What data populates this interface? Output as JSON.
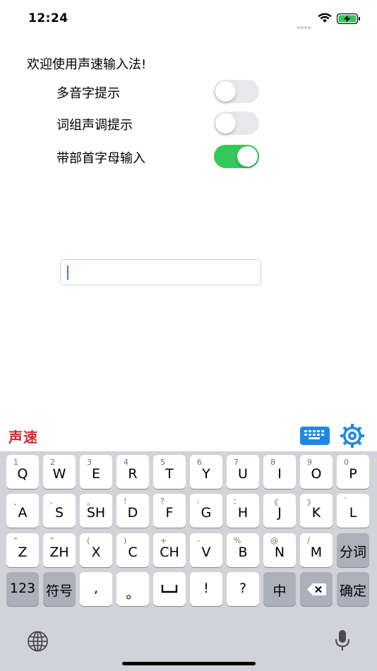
{
  "status_bar": {
    "time": "12:24"
  },
  "settings": {
    "welcome": "欢迎使用声速输入法!",
    "options": [
      {
        "label": "多音字提示",
        "on": false
      },
      {
        "label": "词组声调提示",
        "on": false
      },
      {
        "label": "带部首字母输入",
        "on": true
      }
    ]
  },
  "text_field": {
    "value": ""
  },
  "keyboard": {
    "brand": "声速",
    "rows": [
      [
        {
          "sub": "1",
          "main": "Q"
        },
        {
          "sub": "2",
          "main": "W"
        },
        {
          "sub": "3",
          "main": "E"
        },
        {
          "sub": "4",
          "main": "R"
        },
        {
          "sub": "5",
          "main": "T"
        },
        {
          "sub": "6",
          "main": "Y"
        },
        {
          "sub": "7",
          "main": "U"
        },
        {
          "sub": "8",
          "main": "I"
        },
        {
          "sub": "9",
          "main": "O"
        },
        {
          "sub": "0",
          "main": "P"
        }
      ],
      [
        {
          "sub": "、",
          "main": "A"
        },
        {
          "sub": ",",
          "main": "S"
        },
        {
          "sub": "。",
          "main": "SH"
        },
        {
          "sub": "!",
          "main": "D"
        },
        {
          "sub": "?",
          "main": "F"
        },
        {
          "sub": ":",
          "main": "G"
        },
        {
          "sub": ";",
          "main": "H"
        },
        {
          "sub": "《",
          "main": "J"
        },
        {
          "sub": "》",
          "main": "K"
        },
        {
          "sub": "`",
          "main": "L"
        }
      ],
      [
        {
          "sub": "“",
          "main": "Z"
        },
        {
          "sub": "”",
          "main": "ZH"
        },
        {
          "sub": "(",
          "main": "X"
        },
        {
          "sub": ")",
          "main": "C"
        },
        {
          "sub": "+",
          "main": "CH"
        },
        {
          "sub": "-",
          "main": "V"
        },
        {
          "sub": "%",
          "main": "B"
        },
        {
          "sub": "@",
          "main": "N"
        },
        {
          "sub": "/",
          "main": "M"
        }
      ]
    ],
    "split_word": "分词",
    "bottom_row": {
      "numbers": "123",
      "symbols": "符号",
      "comma": ",",
      "period": "。",
      "exclaim": "!",
      "question": "?",
      "chinese": "中",
      "confirm": "确定"
    }
  }
}
